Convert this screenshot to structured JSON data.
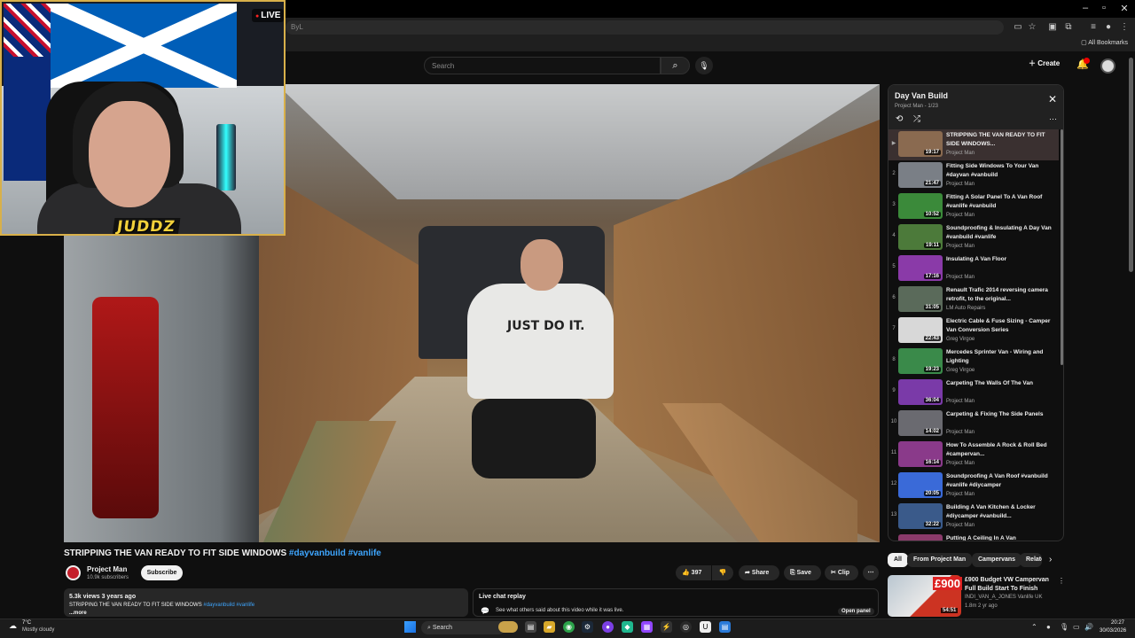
{
  "browser": {
    "url_fragment": "ByL",
    "bookmarks_label": "All Bookmarks",
    "window_controls": [
      "–",
      "▫",
      "✕"
    ]
  },
  "header": {
    "search_placeholder": "Search",
    "create_label": "Create",
    "notification_count": ""
  },
  "webcam": {
    "live_label": "LIVE",
    "streamer_logo": "JUDDZ"
  },
  "video": {
    "title_main": "STRIPPING THE VAN READY TO FIT SIDE WINDOWS",
    "hashtag1": "#dayvanbuild",
    "hashtag2": "#vanlife",
    "shirt_text": "JUST DO IT."
  },
  "channel": {
    "name": "Project Man",
    "subscribers": "10.9k subscribers",
    "subscribe_label": "Subscribe"
  },
  "actions": {
    "like_count": "397",
    "share_label": "Share",
    "save_label": "Save",
    "clip_label": "Clip"
  },
  "description": {
    "meta": "5.3k views  3 years ago",
    "text_main": "STRIPPING THE VAN READY TO FIT SIDE WINDOWS",
    "hashtag1": "#dayvanbuild",
    "hashtag2": "#vanlife",
    "more_label": "...more"
  },
  "live_chat": {
    "title": "Live chat replay",
    "subtitle": "See what others said about this video while it was live.",
    "open_panel_label": "Open panel"
  },
  "playlist": {
    "title": "Day Van Build",
    "subtitle": "Project Man - 1/23",
    "items": [
      {
        "num": "▶",
        "title": "STRIPPING THE VAN READY TO FIT SIDE WINDOWS...",
        "channel": "Project Man",
        "duration": "19:17",
        "color": "#8a6a50"
      },
      {
        "num": "2",
        "title": "Fitting Side Windows To Your Van #dayvan #vanbuild",
        "channel": "Project Man",
        "duration": "21:47",
        "color": "#7a7f86"
      },
      {
        "num": "3",
        "title": "Fitting A Solar Panel To A Van Roof #vanlife #vanbuild",
        "channel": "Project Man",
        "duration": "10:52",
        "color": "#3b8a3a"
      },
      {
        "num": "4",
        "title": "Soundproofing & Insulating A Day Van #vanbuild #vanlife",
        "channel": "Project Man",
        "duration": "19:11",
        "color": "#4c7a3a"
      },
      {
        "num": "5",
        "title": "Insulating A Van Floor",
        "channel": "Project Man",
        "duration": "17:16",
        "color": "#8a3aa8"
      },
      {
        "num": "6",
        "title": "Renault Trafic 2014 reversing camera retrofit, to the original...",
        "channel": "LM Auto Repairs",
        "duration": "31:05",
        "color": "#5a6a5a"
      },
      {
        "num": "7",
        "title": "Electric Cable & Fuse Sizing - Camper Van Conversion Series",
        "channel": "Greg Virgoe",
        "duration": "22:43",
        "color": "#d8d8d8"
      },
      {
        "num": "8",
        "title": "Mercedes Sprinter Van - Wiring and Lighting",
        "channel": "Greg Virgoe",
        "duration": "19:23",
        "color": "#3a8a4a"
      },
      {
        "num": "9",
        "title": "Carpeting The Walls Of The Van",
        "channel": "Project Man",
        "duration": "36:04",
        "color": "#7a3aa8"
      },
      {
        "num": "10",
        "title": "Carpeting & Fixing The Side Panels",
        "channel": "Project Man",
        "duration": "14:02",
        "color": "#6a6a70"
      },
      {
        "num": "11",
        "title": "How To Assemble A Rock & Roll Bed #campervan...",
        "channel": "Project Man",
        "duration": "16:14",
        "color": "#8a3a8a"
      },
      {
        "num": "12",
        "title": "Soundproofing A Van Roof #vanbuild #vanlife #diycamper",
        "channel": "Project Man",
        "duration": "20:05",
        "color": "#3a6ad8"
      },
      {
        "num": "13",
        "title": "Building A Van Kitchen & Locker #diycamper #vanbuild...",
        "channel": "Project Man",
        "duration": "32:22",
        "color": "#3a5a8a"
      },
      {
        "num": "14",
        "title": "Putting A Ceiling In A Van",
        "channel": "",
        "duration": "",
        "color": "#8a3a6a"
      }
    ]
  },
  "chips": {
    "all": "All",
    "from": "From Project Man",
    "campervans": "Campervans",
    "related": "Related"
  },
  "recommended": {
    "price_badge": "£900",
    "title": "£900 Budget VW Campervan Full Build Start To Finish",
    "channel": "INDI_VAN_A_JONES Vanlife UK",
    "meta": "1.8m  2 yr ago",
    "duration": "54:51"
  },
  "taskbar": {
    "weather_temp": "7°C",
    "weather_desc": "Mostly cloudy",
    "search_label": "Search",
    "time": "20:27",
    "date": "30/03/2026"
  }
}
